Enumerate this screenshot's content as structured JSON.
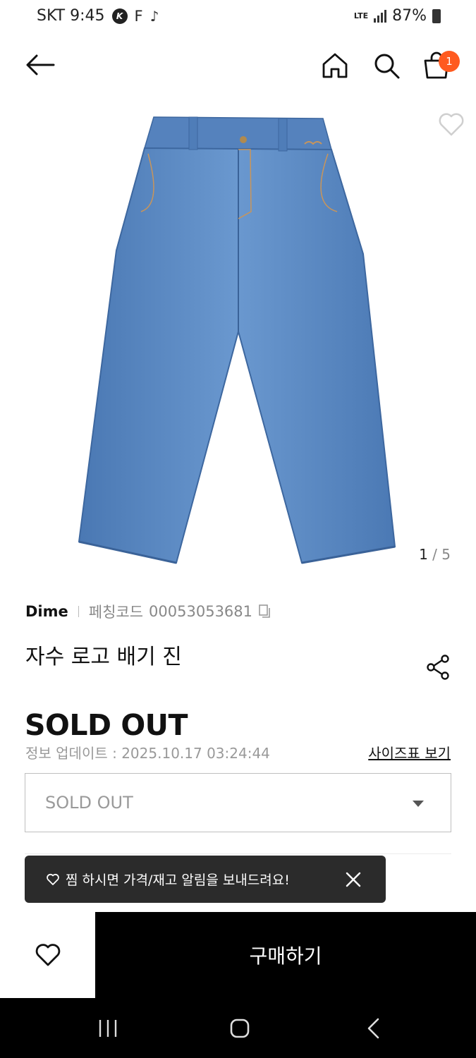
{
  "status_bar": {
    "carrier_time": "SKT 9:45",
    "icons": [
      "k-icon",
      "f-icon",
      "tiktok-icon"
    ],
    "f_label": "F",
    "k_label": "K",
    "network": "LTE",
    "battery": "87%"
  },
  "header": {
    "cart_count": "1",
    "icons": [
      "back-arrow-icon",
      "home-icon",
      "search-icon",
      "cart-icon"
    ]
  },
  "gallery": {
    "current": "1",
    "separator": "/",
    "total": "5"
  },
  "product": {
    "brand": "Dime",
    "code_label": "페칭코드",
    "code_value": "00053053681",
    "name": "자수 로고 배기 진",
    "status_title": "SOLD OUT",
    "update_info": "정보 업데이트 : 2025.10.17 03:24:44",
    "size_chart_link": "사이즈표 보기",
    "option_value": "SOLD OUT"
  },
  "toast": {
    "message": "찜 하시면 가격/재고 알림을 보내드려요!"
  },
  "actions": {
    "buy_label": "구매하기"
  },
  "colors": {
    "accent_badge": "#ff5a1f",
    "buy_button": "#000000",
    "toast_bg": "#2b2b2b",
    "denim": "#5d8cc4"
  }
}
